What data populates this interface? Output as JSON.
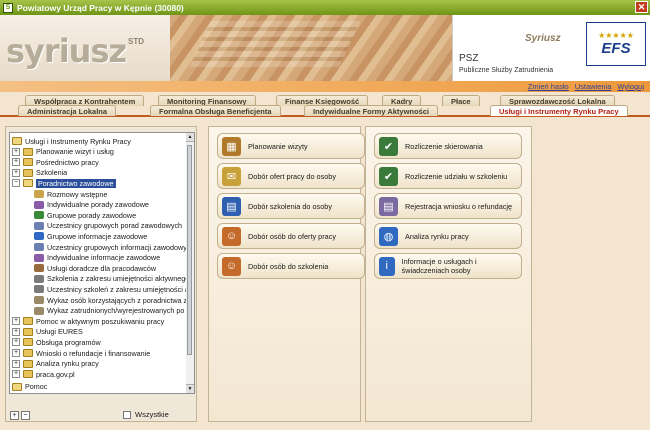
{
  "window": {
    "title": "Powiatowy Urząd Pracy w Kępnie (30080)",
    "close_glyph": "✕"
  },
  "banner": {
    "logo": "syriusz",
    "logo_sup": "STD",
    "psz": "PSZ",
    "psz_sub": "Publiczne Służby Zatrudnienia",
    "mini_logo": "Syriusz",
    "efs_stars": "★★★★★",
    "efs": "EFS"
  },
  "toplinks": [
    "Zmień hasło",
    "Ustawienia",
    "Wyloguj"
  ],
  "tabs": {
    "row1": [
      "Współpraca z Kontrahentem",
      "Monitoring Finansowy",
      "Finanse Księgowość",
      "Kadry",
      "Płace",
      "Sprawozdawczość Lokalna"
    ],
    "row2": [
      "Administracja Lokalna",
      "Formalna Obsługa Beneficjenta",
      "Indywidualne Formy Aktywności",
      "Usługi i Instrumenty Rynku Pracy"
    ],
    "active": "Usługi i Instrumenty Rynku Pracy"
  },
  "tree": {
    "root": "Usługi i Instrumenty Rynku Pracy",
    "items": [
      {
        "label": "Planowanie wizyt i usług",
        "type": "folder",
        "expander": "+"
      },
      {
        "label": "Pośrednictwo pracy",
        "type": "folder",
        "expander": "+"
      },
      {
        "label": "Szkolenia",
        "type": "folder",
        "expander": "+"
      },
      {
        "label": "Poradnictwo zawodowe",
        "type": "folder-open",
        "expander": "−",
        "selected": true
      },
      {
        "label": "Rozmowy wstępne",
        "type": "leaf",
        "color": "#c9a44a"
      },
      {
        "label": "Indywidualne porady zawodowe",
        "type": "leaf",
        "color": "#8a5ba7"
      },
      {
        "label": "Grupowe porady zawodowe",
        "type": "leaf",
        "color": "#3b8a3a"
      },
      {
        "label": "Uczestnicy grupowych porad zawodowych",
        "type": "leaf",
        "color": "#6b7fb3"
      },
      {
        "label": "Grupowe informacje zawodowe",
        "type": "leaf",
        "color": "#2f68c4"
      },
      {
        "label": "Uczestnicy grupowych informacji zawodowych",
        "type": "leaf",
        "color": "#6b7fb3"
      },
      {
        "label": "Indywidualne informacje zawodowe",
        "type": "leaf",
        "color": "#8a5ba7"
      },
      {
        "label": "Usługi doradcze dla pracodawców",
        "type": "leaf",
        "color": "#9a6b3a"
      },
      {
        "label": "Szkolenia z zakresu umiejętności aktywnego poszukiwania pracy",
        "type": "leaf",
        "color": "#7a7a7a"
      },
      {
        "label": "Uczestnicy szkoleń z zakresu umiejętności aktywnego poszukiwania pracy",
        "type": "leaf",
        "color": "#7a7a7a"
      },
      {
        "label": "Wykaz osób korzystających z poradnictwa zawodowego",
        "type": "leaf",
        "color": "#9a8a6a"
      },
      {
        "label": "Wykaz zatrudnionych/wyrejestrowanych po poradnictwie",
        "type": "leaf",
        "color": "#9a8a6a"
      },
      {
        "label": "Pomoc w aktywnym poszukiwaniu pracy",
        "type": "folder",
        "expander": "+"
      },
      {
        "label": "Usługi EURES",
        "type": "folder",
        "expander": "+"
      },
      {
        "label": "Obsługa programów",
        "type": "folder",
        "expander": "+"
      },
      {
        "label": "Wnioski o refundacje i finansowanie",
        "type": "folder",
        "expander": "+"
      },
      {
        "label": "Analiza rynku pracy",
        "type": "folder",
        "expander": "+"
      },
      {
        "label": "praca.gov.pl",
        "type": "folder",
        "expander": "+"
      }
    ],
    "root2": "Pomoc",
    "footer": {
      "expand": "+",
      "collapse": "−",
      "all_label": "Wszystkie"
    },
    "scroll": {
      "up": "▲",
      "down": "▼"
    }
  },
  "panel_left_buttons": [
    {
      "label": "Planowanie wizyty",
      "icon": "calendar-icon",
      "color": "#b07a2a",
      "glyph": "▦"
    },
    {
      "label": "Dobór ofert pracy do osoby",
      "icon": "offers-icon",
      "color": "#c8a13a",
      "glyph": "✉"
    },
    {
      "label": "Dobór szkolenia do osoby",
      "icon": "training-icon",
      "color": "#2f5fb0",
      "glyph": "▤"
    },
    {
      "label": "Dobór osób do oferty pracy",
      "icon": "person-offer-icon",
      "color": "#c46a2a",
      "glyph": "☺"
    },
    {
      "label": "Dobór osób do szkolenia",
      "icon": "person-training-icon",
      "color": "#c46a2a",
      "glyph": "☺"
    }
  ],
  "panel_right_buttons": [
    {
      "label": "Rozliczenie skierowania",
      "icon": "person-check-icon",
      "color": "#3a7a3a",
      "glyph": "✔"
    },
    {
      "label": "Rozliczenie udziału w szkoleniu",
      "icon": "person-check-icon",
      "color": "#3a7a3a",
      "glyph": "✔"
    },
    {
      "label": "Rejestracja wniosku o refundację",
      "icon": "document-icon",
      "color": "#7a6aa0",
      "glyph": "▤"
    },
    {
      "label": "Analiza rynku pracy",
      "icon": "globe-icon",
      "color": "#2f6ac0",
      "glyph": "◍"
    },
    {
      "label": "Informacje o usługach i świadczeniach osoby",
      "icon": "person-info-icon",
      "color": "#2f6ac0",
      "glyph": "i"
    }
  ]
}
